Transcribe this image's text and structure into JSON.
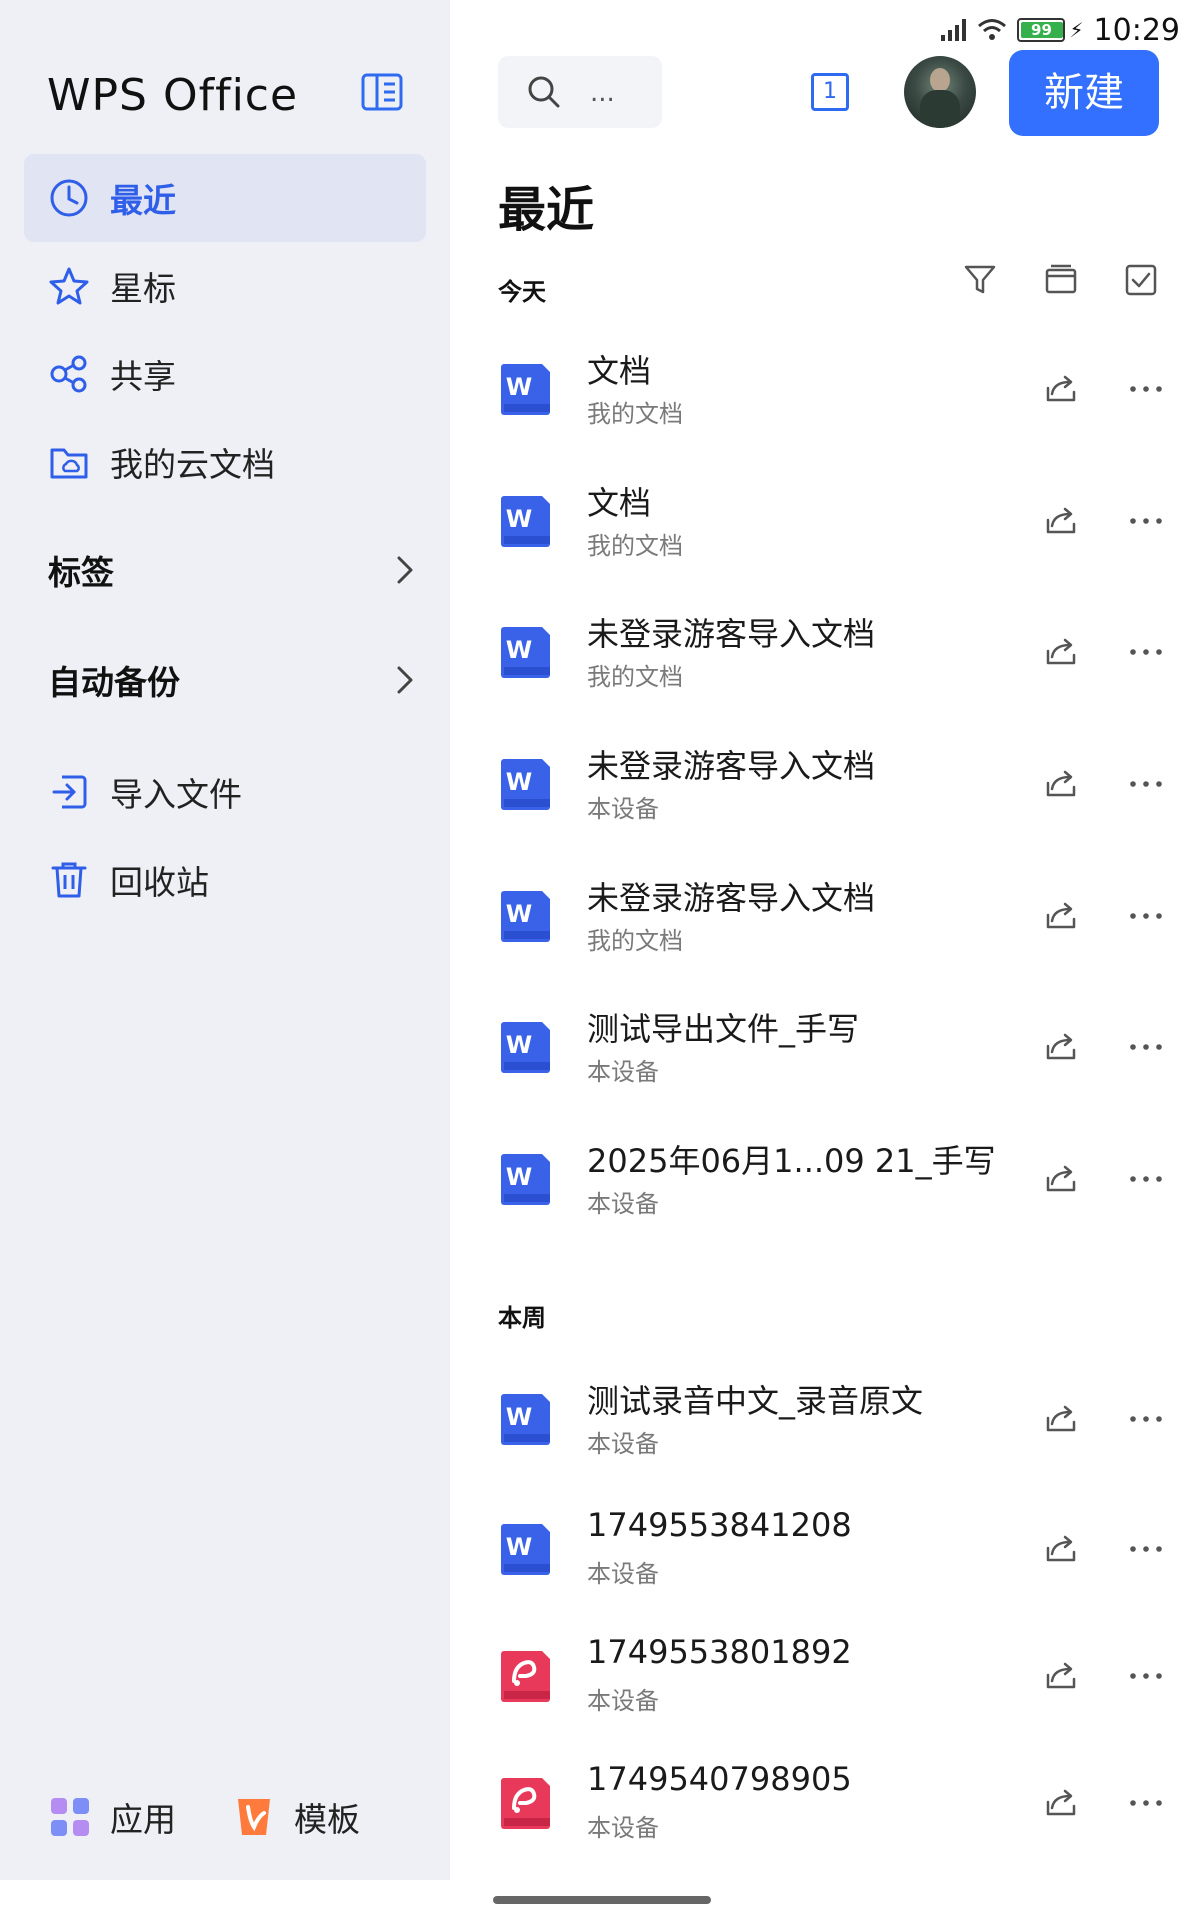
{
  "status_bar": {
    "time": "10:29",
    "battery": "99"
  },
  "sidebar": {
    "logo": "WPS Office",
    "nav": [
      {
        "label": "最近",
        "icon": "clock-icon",
        "active": true
      },
      {
        "label": "星标",
        "icon": "star-icon"
      },
      {
        "label": "共享",
        "icon": "share-nodes-icon"
      },
      {
        "label": "我的云文档",
        "icon": "cloud-folder-icon"
      }
    ],
    "sections": [
      {
        "label": "标签"
      },
      {
        "label": "自动备份"
      }
    ],
    "tools": [
      {
        "label": "导入文件",
        "icon": "import-icon"
      },
      {
        "label": "回收站",
        "icon": "trash-icon"
      }
    ],
    "bottom": [
      {
        "label": "应用",
        "icon": "apps-grid-icon"
      },
      {
        "label": "模板",
        "icon": "template-icon"
      }
    ]
  },
  "header": {
    "search_placeholder": "...",
    "tab_count": "1",
    "new_button": "新建"
  },
  "main": {
    "title": "最近",
    "groups": [
      {
        "label": "今天",
        "files": [
          {
            "name": "文档",
            "location": "我的文档",
            "type": "word"
          },
          {
            "name": "文档",
            "location": "我的文档",
            "type": "word"
          },
          {
            "name": "未登录游客导入文档",
            "location": "我的文档",
            "type": "word"
          },
          {
            "name": "未登录游客导入文档",
            "location": "本设备",
            "type": "word"
          },
          {
            "name": "未登录游客导入文档",
            "location": "我的文档",
            "type": "word"
          },
          {
            "name": "测试导出文件_手写",
            "location": "本设备",
            "type": "word"
          },
          {
            "name": "2025年06月1...09 21_手写",
            "location": "本设备",
            "type": "word"
          }
        ]
      },
      {
        "label": "本周",
        "files": [
          {
            "name": "测试录音中文_录音原文",
            "location": "本设备",
            "type": "word"
          },
          {
            "name": "1749553841208",
            "location": "本设备",
            "type": "word"
          },
          {
            "name": "1749553801892",
            "location": "本设备",
            "type": "pdf"
          },
          {
            "name": "1749540798905",
            "location": "本设备",
            "type": "pdf"
          }
        ]
      }
    ]
  },
  "colors": {
    "accent": "#3370ff",
    "word": "#3a62e8",
    "pdf": "#e8395a",
    "sidebar_bg": "#eef0f5"
  }
}
